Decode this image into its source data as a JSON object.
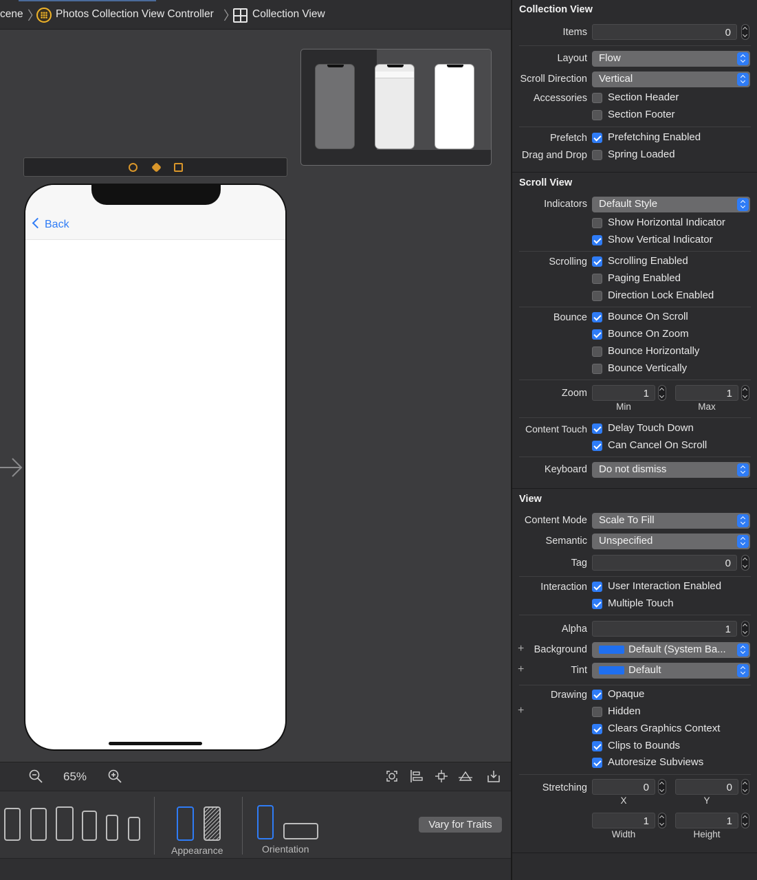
{
  "breadcrumb": {
    "scene": "cene",
    "controller": "Photos Collection View Controller",
    "view": "Collection View"
  },
  "phone": {
    "back_label": "Back"
  },
  "zoom": {
    "level": "65%"
  },
  "device_bar": {
    "appearance_label": "Appearance",
    "orientation_label": "Orientation",
    "vary_button": "Vary for Traits"
  },
  "inspector": {
    "collection_view": {
      "title": "Collection View",
      "items_label": "Items",
      "items_value": "0",
      "layout_label": "Layout",
      "layout_value": "Flow",
      "scroll_direction_label": "Scroll Direction",
      "scroll_direction_value": "Vertical",
      "accessories_label": "Accessories",
      "section_header": {
        "label": "Section Header",
        "checked": false
      },
      "section_footer": {
        "label": "Section Footer",
        "checked": false
      },
      "prefetch_label": "Prefetch",
      "prefetching_enabled": {
        "label": "Prefetching Enabled",
        "checked": true
      },
      "drag_drop_label": "Drag and Drop",
      "spring_loaded": {
        "label": "Spring Loaded",
        "checked": false
      }
    },
    "scroll_view": {
      "title": "Scroll View",
      "indicators_label": "Indicators",
      "indicators_value": "Default Style",
      "show_horizontal": {
        "label": "Show Horizontal Indicator",
        "checked": false
      },
      "show_vertical": {
        "label": "Show Vertical Indicator",
        "checked": true
      },
      "scrolling_label": "Scrolling",
      "scrolling_enabled": {
        "label": "Scrolling Enabled",
        "checked": true
      },
      "paging_enabled": {
        "label": "Paging Enabled",
        "checked": false
      },
      "direction_lock": {
        "label": "Direction Lock Enabled",
        "checked": false
      },
      "bounce_label": "Bounce",
      "bounce_on_scroll": {
        "label": "Bounce On Scroll",
        "checked": true
      },
      "bounce_on_zoom": {
        "label": "Bounce On Zoom",
        "checked": true
      },
      "bounce_horizontally": {
        "label": "Bounce Horizontally",
        "checked": false
      },
      "bounce_vertically": {
        "label": "Bounce Vertically",
        "checked": false
      },
      "zoom_label": "Zoom",
      "zoom_min_value": "1",
      "zoom_max_value": "1",
      "zoom_min_label": "Min",
      "zoom_max_label": "Max",
      "content_touch_label": "Content Touch",
      "delay_touch_down": {
        "label": "Delay Touch Down",
        "checked": true
      },
      "can_cancel_on_scroll": {
        "label": "Can Cancel On Scroll",
        "checked": true
      },
      "keyboard_label": "Keyboard",
      "keyboard_value": "Do not dismiss"
    },
    "view": {
      "title": "View",
      "content_mode_label": "Content Mode",
      "content_mode_value": "Scale To Fill",
      "semantic_label": "Semantic",
      "semantic_value": "Unspecified",
      "tag_label": "Tag",
      "tag_value": "0",
      "interaction_label": "Interaction",
      "user_interaction": {
        "label": "User Interaction Enabled",
        "checked": true
      },
      "multiple_touch": {
        "label": "Multiple Touch",
        "checked": true
      },
      "alpha_label": "Alpha",
      "alpha_value": "1",
      "background_label": "Background",
      "background_value": "Default (System Ba...",
      "tint_label": "Tint",
      "tint_value": "Default",
      "drawing_label": "Drawing",
      "opaque": {
        "label": "Opaque",
        "checked": true
      },
      "hidden": {
        "label": "Hidden",
        "checked": false
      },
      "clears_graphics": {
        "label": "Clears Graphics Context",
        "checked": true
      },
      "clips_to_bounds": {
        "label": "Clips to Bounds",
        "checked": true
      },
      "autoresize": {
        "label": "Autoresize Subviews",
        "checked": true
      },
      "stretching_label": "Stretching",
      "stretch_x_value": "0",
      "stretch_y_value": "0",
      "stretch_x_label": "X",
      "stretch_y_label": "Y",
      "stretch_w_value": "1",
      "stretch_h_value": "1",
      "stretch_w_label": "Width",
      "stretch_h_label": "Height"
    }
  },
  "colors": {
    "accent": "#2f7cf6",
    "scene_icon": "#f0b429",
    "swatch_blue": "#1f6ff0"
  }
}
